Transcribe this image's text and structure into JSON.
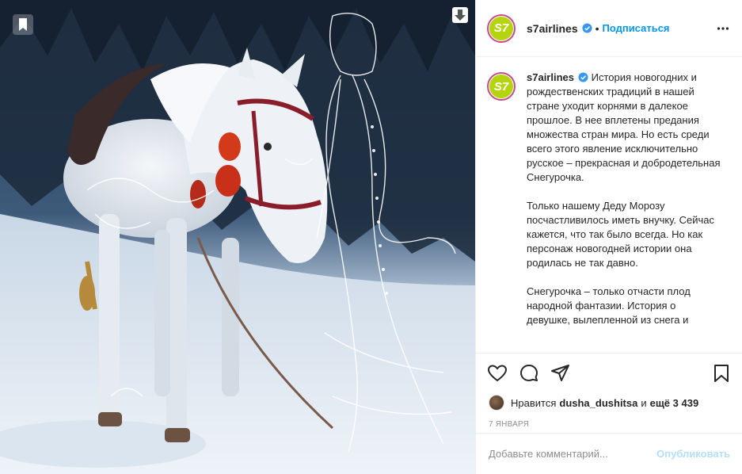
{
  "account": {
    "username": "s7airlines",
    "avatar_text": "S7",
    "follow_label": "Подписаться",
    "separator": "•"
  },
  "caption": {
    "username": "s7airlines",
    "text": "История новогодних и рождественских традиций в нашей стране уходит корнями в далекое прошлое. В нее вплетены предания множества стран мира. Но есть среди всего этого явление исключительно русское – прекрасная и добродетельная Снегурочка.\n\nТолько нашему Деду Морозу посчастливилось иметь внучку. Сейчас кажется, что так было всегда. Но как персонаж новогодней истории она родилась не так давно.\n\nСнегурочка – только отчасти плод народной фантазии. История о девушке, вылепленной из снега и"
  },
  "likes": {
    "prefix": "Нравится",
    "user": "dusha_dushitsa",
    "and": "и",
    "others": "ещё 3 439"
  },
  "date": "7 ЯНВАРЯ",
  "comment": {
    "placeholder": "Добавьте комментарий...",
    "publish_label": "Опубликовать"
  },
  "colors": {
    "brand_green": "#b5d40f",
    "story_ring": "#c64a8c",
    "link_blue": "#0095f6",
    "publish_disabled": "#b2dffc",
    "verified_blue": "#3897f0"
  },
  "icons": {
    "media_left": "collection-icon",
    "media_right": "download-icon",
    "more": "more-options-icon",
    "like": "heart-icon",
    "comment": "comment-icon",
    "share": "share-icon",
    "save": "bookmark-icon",
    "verified": "verified-badge-icon"
  }
}
